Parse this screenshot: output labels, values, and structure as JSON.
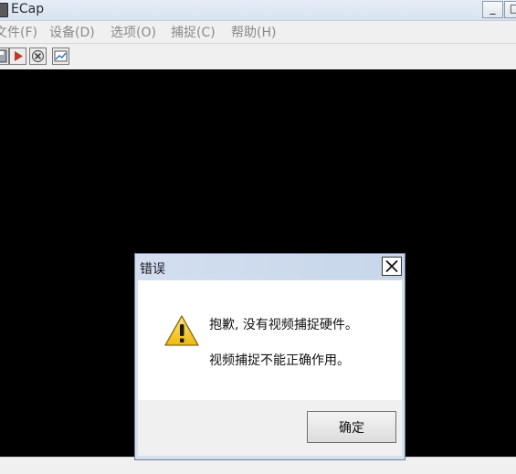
{
  "window": {
    "title": "ECap",
    "minimize_glyph": "_",
    "maximize_glyph": "□"
  },
  "menu": {
    "items": [
      {
        "label": "文件(F)"
      },
      {
        "label": "设备(D)"
      },
      {
        "label": "选项(O)"
      },
      {
        "label": "捕捉(C)"
      },
      {
        "label": "帮助(H)"
      }
    ]
  },
  "toolbar": {
    "buttons": [
      {
        "icon": "save-icon"
      },
      {
        "icon": "play-icon",
        "color": "#c0392b"
      },
      {
        "icon": "stop-icon"
      },
      {
        "icon": "image-icon"
      }
    ]
  },
  "dialog": {
    "title": "错误",
    "icon": "warning-icon",
    "message_line1": "抱歉, 没有视频捕捉硬件。",
    "message_line2": "视频捕捉不能正确作用。",
    "ok_label": "确定"
  },
  "colors": {
    "video_background": "#000000",
    "warning_yellow": "#f3c21b"
  }
}
